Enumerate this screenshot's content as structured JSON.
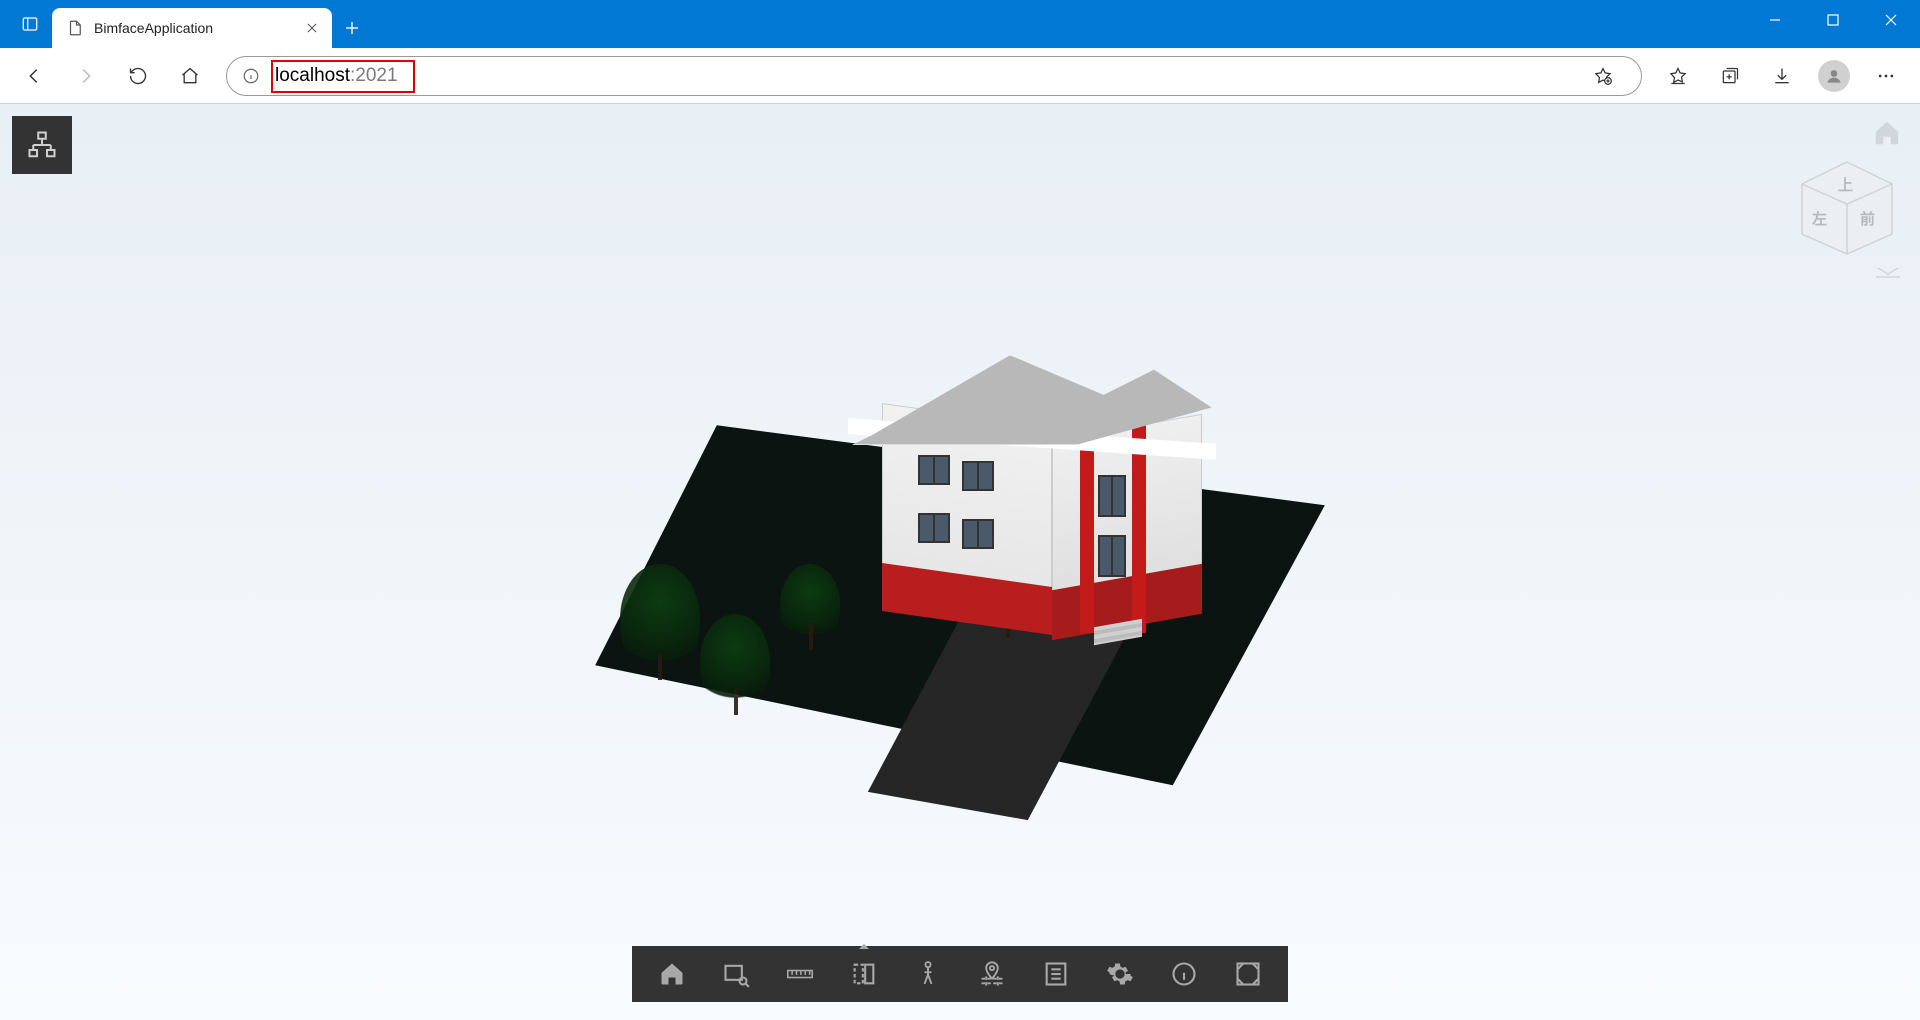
{
  "browser": {
    "tab_title": "BimfaceApplication",
    "url_host": "localhost",
    "url_port": ":2021"
  },
  "viewcube": {
    "top": "上",
    "left": "左",
    "front": "前"
  },
  "toolbar": {
    "hierarchy": "hierarchy",
    "home": "home",
    "zoom_rect": "zoom-rectangle",
    "measure": "measure",
    "section": "section",
    "walk": "walk",
    "map": "map",
    "properties": "properties",
    "settings": "settings",
    "info": "info",
    "fullscreen": "fullscreen"
  }
}
